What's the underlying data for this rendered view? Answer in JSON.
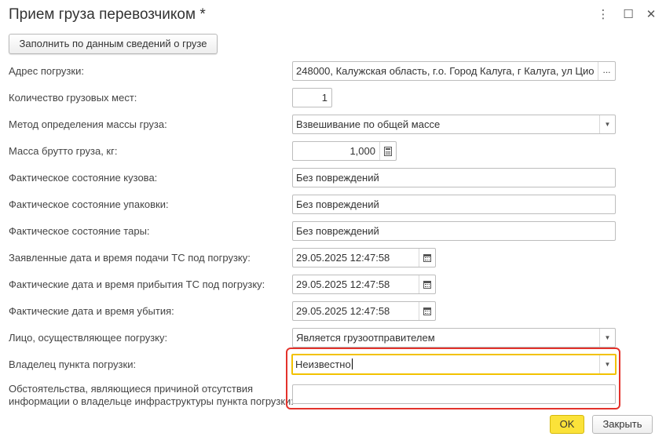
{
  "window": {
    "title": "Прием груза перевозчиком *",
    "menu_icon": "⋮",
    "maximize_icon": "☐",
    "close_icon": "✕"
  },
  "toolbar": {
    "fill_label": "Заполнить по данным сведений о грузе"
  },
  "fields": {
    "address": {
      "label": "Адрес погрузки:",
      "value": "248000, Калужская область, г.о. Город Калуга, г Калуга, ул Цио",
      "button": "..."
    },
    "places": {
      "label": "Количество грузовых мест:",
      "value": "1"
    },
    "mass_method": {
      "label": "Метод определения массы груза:",
      "value": "Взвешивание по общей массе"
    },
    "gross_mass": {
      "label": "Масса брутто груза, кг:",
      "value": "1,000"
    },
    "body_state": {
      "label": "Фактическое состояние кузова:",
      "value": "Без повреждений"
    },
    "package_state": {
      "label": "Фактическое состояние упаковки:",
      "value": "Без повреждений"
    },
    "tare_state": {
      "label": "Фактическое состояние тары:",
      "value": "Без повреждений"
    },
    "declared_dt": {
      "label": "Заявленные дата и время подачи ТС под погрузку:",
      "value": "29.05.2025 12:47:58"
    },
    "arrival_dt": {
      "label": "Фактические дата и время прибытия ТС под погрузку:",
      "value": "29.05.2025 12:47:58"
    },
    "departure_dt": {
      "label": "Фактические дата и время убытия:",
      "value": "29.05.2025 12:47:58"
    },
    "loader": {
      "label": "Лицо, осуществляющее погрузку:",
      "value": "Является грузоотправителем"
    },
    "owner": {
      "label": "Владелец пункта погрузки:",
      "value": "Неизвестно"
    },
    "circumstances": {
      "label_line1": "Обстоятельства, являющиеся причиной отсутствия",
      "label_line2": "информации о владельце инфраструктуры пункта погрузки:",
      "value": ""
    }
  },
  "buttons": {
    "ok": "OK",
    "close": "Закрыть"
  },
  "colors": {
    "ok_bg": "#fbe239",
    "highlight_border": "#e3322b",
    "focus_border": "#f2c200"
  }
}
